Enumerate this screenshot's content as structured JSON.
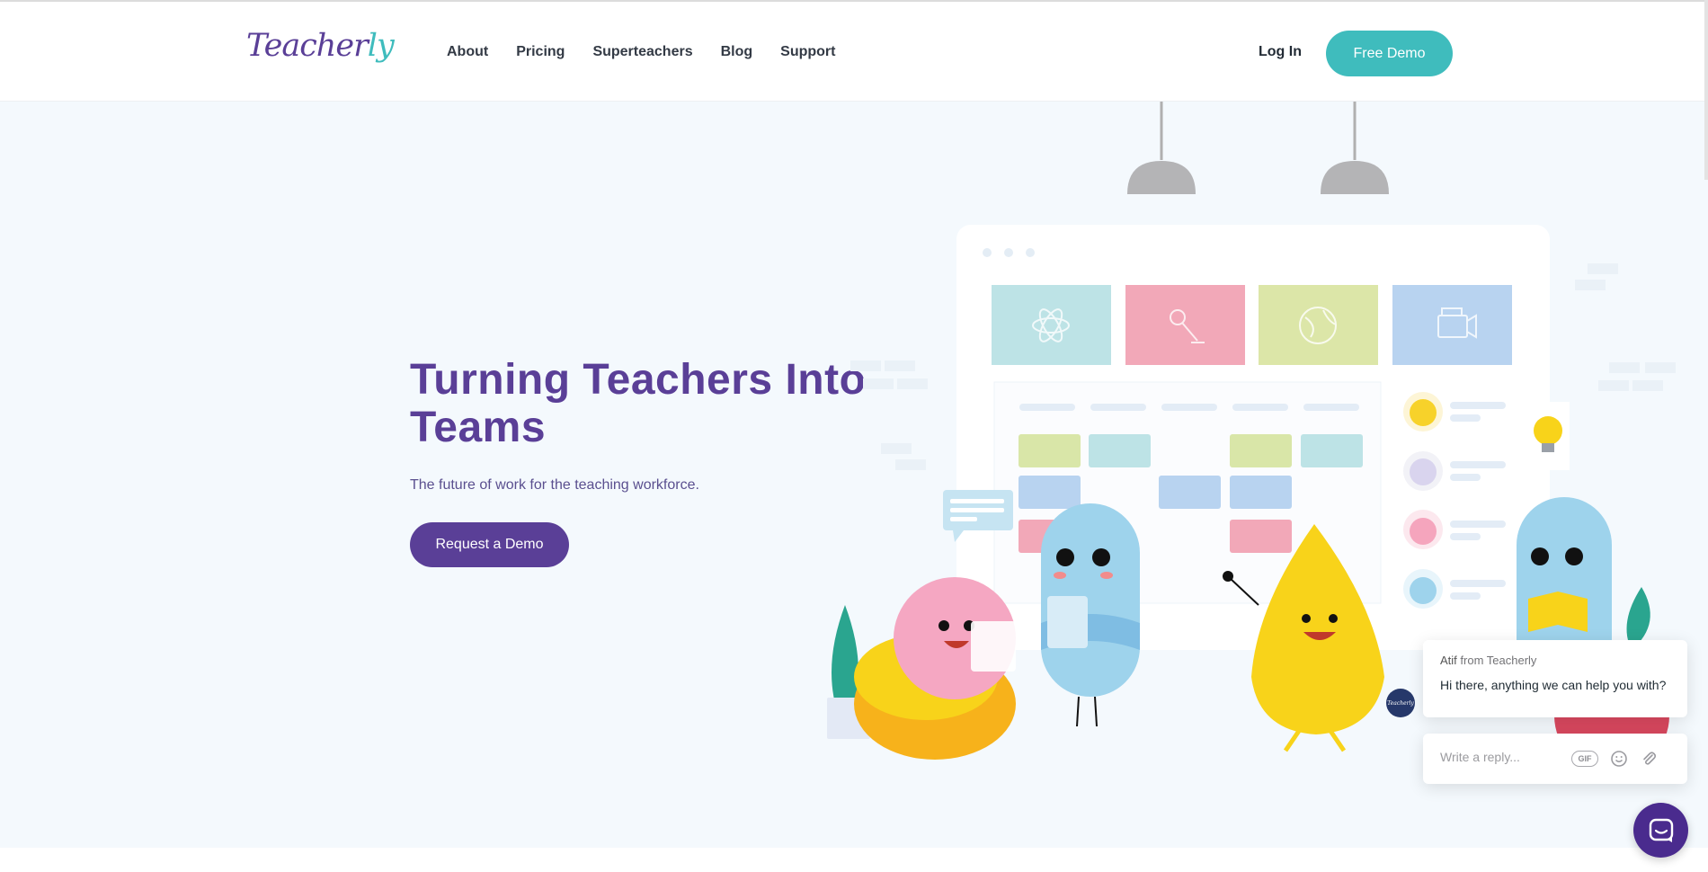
{
  "logo": {
    "text_main": "Teacher",
    "text_accent": "ly"
  },
  "nav": {
    "items": [
      {
        "label": "About"
      },
      {
        "label": "Pricing"
      },
      {
        "label": "Superteachers"
      },
      {
        "label": "Blog"
      },
      {
        "label": "Support"
      }
    ],
    "login_label": "Log In",
    "free_demo_label": "Free Demo"
  },
  "hero": {
    "title": "Turning Teachers Into Teams",
    "subtitle": "The future of work for the teaching workforce.",
    "cta_label": "Request a Demo"
  },
  "chat": {
    "sender_name": "Atif",
    "sender_suffix": "from Teacherly",
    "message": "Hi there, anything we can help you with?",
    "reply_placeholder": "Write a reply...",
    "gif_label": "GIF",
    "avatar_text": "Teacherly"
  },
  "colors": {
    "brand_purple": "#5a3f97",
    "brand_teal": "#3fbcbd",
    "hero_bg": "#f4f9fd",
    "launcher": "#4a2b8e"
  },
  "icons": [
    "atom-icon",
    "microphone-icon",
    "globe-icon",
    "camera-icon",
    "lightbulb-icon",
    "gif-icon",
    "emoji-icon",
    "attachment-icon",
    "chat-launcher-icon"
  ]
}
